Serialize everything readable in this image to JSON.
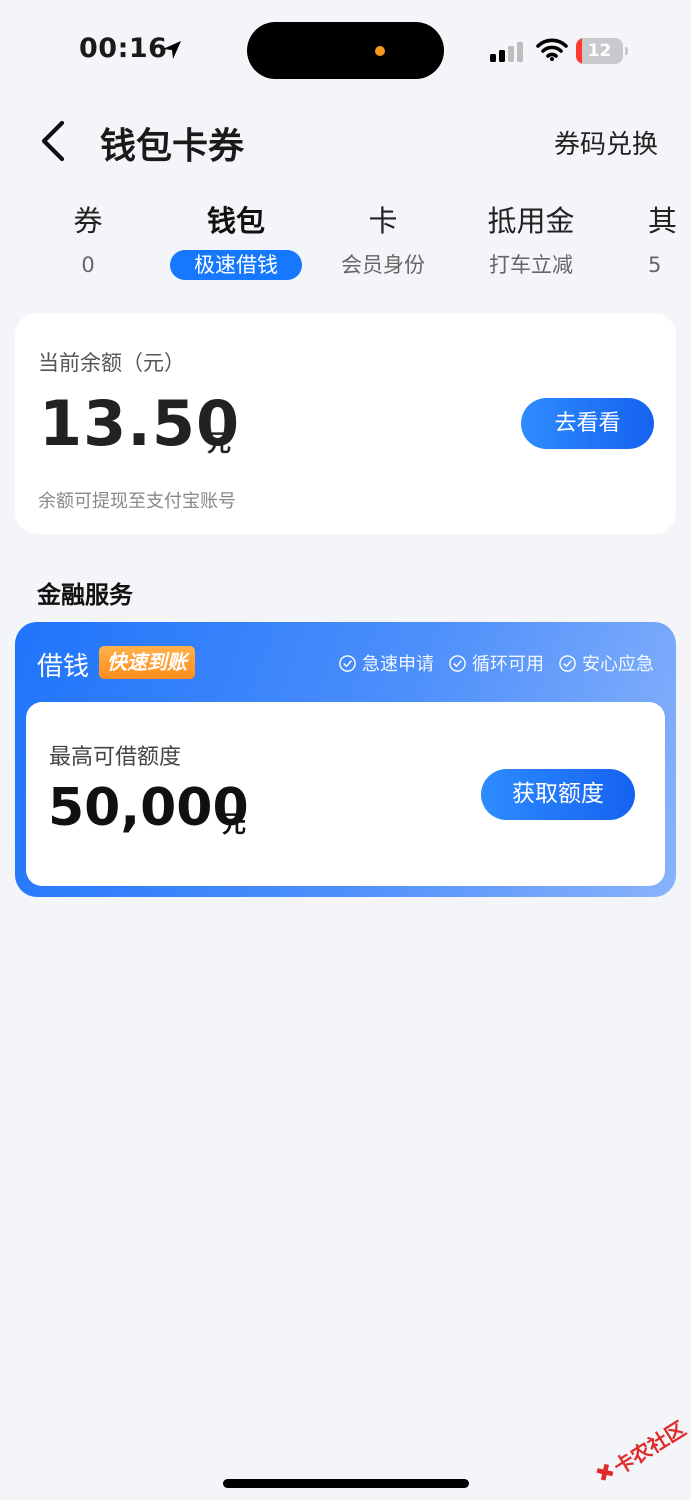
{
  "status_bar": {
    "time": "00:16",
    "battery": "12",
    "battery_level": 0.12
  },
  "header": {
    "title": "钱包卡券",
    "redeem": "券码兑换"
  },
  "tabs": [
    {
      "label": "券",
      "sub": "0",
      "active": false
    },
    {
      "label": "钱包",
      "sub": "极速借钱",
      "active": true
    },
    {
      "label": "卡",
      "sub": "会员身份",
      "active": false
    },
    {
      "label": "抵用金",
      "sub": "打车立减",
      "active": false
    },
    {
      "label": "其",
      "sub": "5",
      "active": false
    }
  ],
  "balance": {
    "label": "当前余额（元）",
    "amount": "13.50",
    "unit": "元",
    "note": "余额可提现至支付宝账号",
    "button": "去看看"
  },
  "finance": {
    "section_title": "金融服务",
    "loan_title": "借钱",
    "badge": "快速到账",
    "features": [
      "急速申请",
      "循环可用",
      "安心应急"
    ],
    "limit_label": "最高可借额度",
    "limit_amount": "50,000",
    "limit_unit": "元",
    "button": "获取额度"
  },
  "watermark": {
    "text": "卡农社区"
  },
  "colors": {
    "accent": "#1677ff",
    "badge": "#ff8c1a",
    "battery_low": "#ff3b30"
  }
}
